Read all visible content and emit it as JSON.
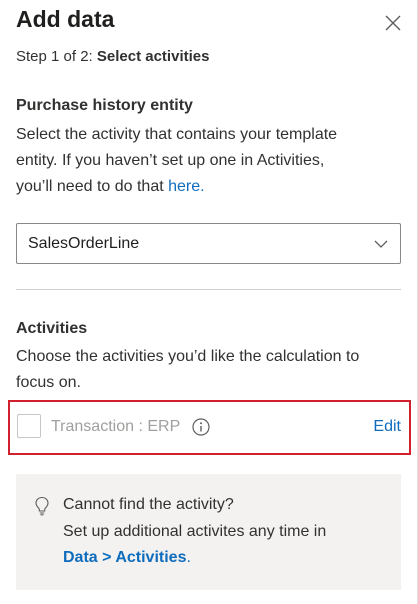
{
  "panel": {
    "title": "Add data",
    "close_icon": "close-icon"
  },
  "step": {
    "prefix": "Step 1 of 2: ",
    "current": "Select activities"
  },
  "purchase_history": {
    "heading": "Purchase history entity",
    "description_line1": "Select the activity that contains your template",
    "description_line2": "entity. If you haven’t set up one in Activities,",
    "description_line3_prefix": "you’ll need to do that ",
    "link_text": "here",
    "link_suffix": ".",
    "dropdown_value": "SalesOrderLine",
    "dropdown_icon": "chevron-down-icon"
  },
  "activities": {
    "heading": "Activities",
    "description_line1": "Choose the activities you’d like the calculation to",
    "description_line2": "focus on.",
    "item_label": "Transaction : ERP",
    "item_checked": false,
    "info_icon": "info-icon",
    "edit_label": "Edit",
    "highlight_color": "#d1202e"
  },
  "tip": {
    "icon": "lightbulb-icon",
    "line1": "Cannot find the activity?",
    "line2": "Set up additional activites any time in",
    "link_text": "Data > Activities",
    "link_suffix": "."
  },
  "colors": {
    "link": "#0f6cbd",
    "text": "#323130",
    "disabled_text": "#a19f9d",
    "tip_background": "#f3f2f1"
  }
}
